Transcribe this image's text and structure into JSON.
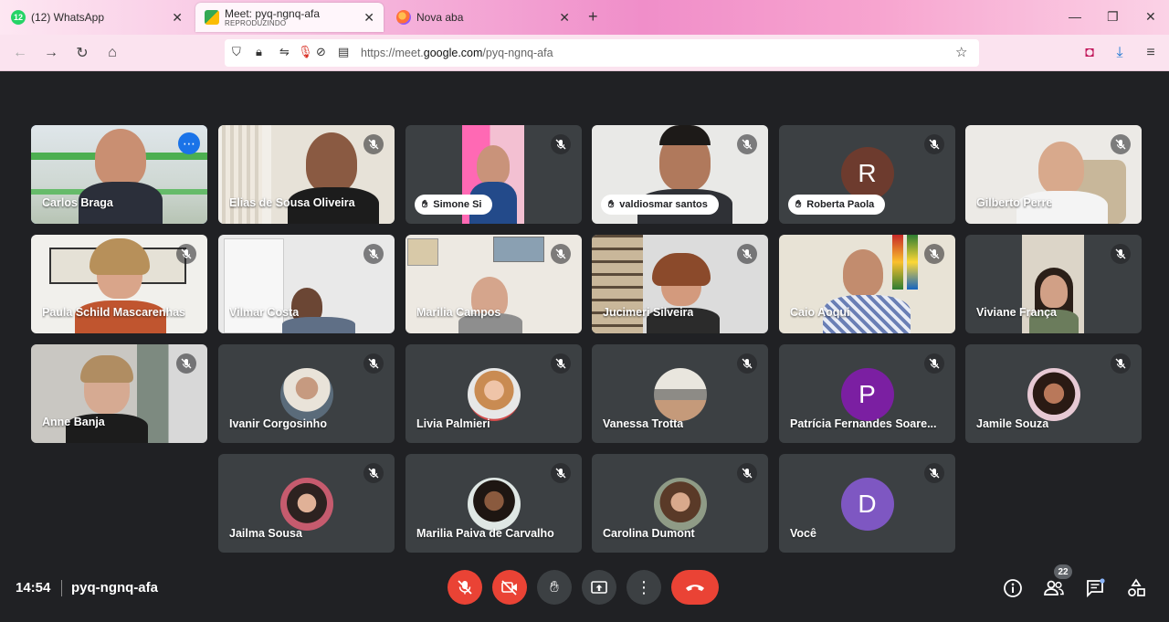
{
  "browser": {
    "tabs": [
      {
        "title": "(12) WhatsApp",
        "subtitle": ""
      },
      {
        "title": "Meet: pyq-ngnq-afa",
        "subtitle": "REPRODUZINDO"
      },
      {
        "title": "Nova aba",
        "subtitle": ""
      }
    ],
    "url_prefix": "https://meet.",
    "url_domain": "google.com",
    "url_path": "/pyq-ngnq-afa",
    "whatsapp_count": "12"
  },
  "tiles": [
    {
      "name": "Carlos Braga",
      "type": "video"
    },
    {
      "name": "Elias de Sousa Oliveira",
      "type": "video"
    },
    {
      "name": "Simone Si",
      "type": "video",
      "hand": true
    },
    {
      "name": "valdiosmar santos",
      "type": "video",
      "hand": true
    },
    {
      "name": "Roberta Paola",
      "type": "avatar",
      "initial": "R",
      "hand": true
    },
    {
      "name": "Gilberto Perre",
      "type": "video"
    },
    {
      "name": "Paula Schild Mascarenhas",
      "type": "video"
    },
    {
      "name": "Vilmar Costa",
      "type": "video"
    },
    {
      "name": "Marilia Campos",
      "type": "video"
    },
    {
      "name": "Jucimeri Silveira",
      "type": "video"
    },
    {
      "name": "Caio Aoqui",
      "type": "video"
    },
    {
      "name": "Viviane França",
      "type": "video"
    },
    {
      "name": "Anne Banja",
      "type": "video"
    },
    {
      "name": "Ivanir Corgosinho",
      "type": "photo"
    },
    {
      "name": "Livia Palmieri",
      "type": "photo"
    },
    {
      "name": "Vanessa Trotta",
      "type": "photo"
    },
    {
      "name": "Patrícia Fernandes Soare...",
      "type": "avatar",
      "initial": "P"
    },
    {
      "name": "Jamile Souza",
      "type": "photo"
    },
    {
      "name": "Jailma Sousa",
      "type": "photo"
    },
    {
      "name": "Marilia Paiva de Carvalho",
      "type": "photo"
    },
    {
      "name": "Carolina Dumont",
      "type": "photo"
    },
    {
      "name": "Você",
      "type": "avatar",
      "initial": "D"
    }
  ],
  "bottom": {
    "time": "14:54",
    "meeting_code": "pyq-ngnq-afa",
    "participants_count": "22"
  },
  "colors": {
    "accent": "#8ab4f8",
    "danger": "#ea4335",
    "avatar_r": "#6d3b2e",
    "avatar_p": "#7b1fa2",
    "avatar_d": "#7e57c2"
  }
}
